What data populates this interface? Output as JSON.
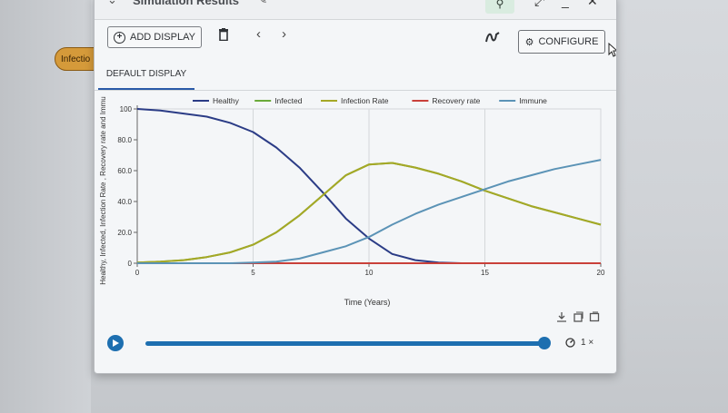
{
  "background": {
    "pill_text": "Infectio"
  },
  "window": {
    "title": "Simulation Results",
    "controls": {
      "minimize": "_",
      "maximize": "⤢",
      "close": "✕"
    }
  },
  "toolbar": {
    "add_display_label": "ADD DISPLAY",
    "configure_label": "CONFIGURE",
    "prev_label": "‹",
    "next_label": "›"
  },
  "tabs": [
    {
      "label": "DEFAULT DISPLAY",
      "active": true
    }
  ],
  "colors": {
    "healthy": "#2b3c86",
    "infected": "#6aaa3a",
    "infection_rate": "#a5a826",
    "recovery_rate": "#c9403a",
    "immune": "#5b93b6",
    "accent": "#1d6fb0"
  },
  "player": {
    "speed_label": "1 ×",
    "progress": 1.0
  },
  "chart_data": {
    "type": "line",
    "title": "",
    "xlabel": "Time (Years)",
    "ylabel": "Healthy, Infected, Infection Rate , Recovery rate and Immu",
    "xlim": [
      0,
      20
    ],
    "ylim": [
      0,
      100
    ],
    "xticks": [
      "0",
      "5",
      "10",
      "15",
      "20"
    ],
    "yticks": [
      "0",
      "20.0",
      "40.0",
      "60.0",
      "80.0",
      "100"
    ],
    "grid": "vertical",
    "legend": "top",
    "x": [
      0,
      1,
      2,
      3,
      4,
      5,
      6,
      7,
      8,
      9,
      10,
      11,
      12,
      13,
      14,
      15,
      16,
      17,
      18,
      19,
      20
    ],
    "series": [
      {
        "name": "Healthy",
        "color": "#2b3c86",
        "values": [
          100,
          99,
          97,
          95,
          91,
          85,
          75,
          62,
          46,
          29,
          16,
          6,
          2,
          0.5,
          0,
          0,
          0,
          0,
          0,
          0,
          0
        ]
      },
      {
        "name": "Infected",
        "color": "#6aaa3a",
        "values": [
          0.5,
          1,
          2,
          4,
          7,
          12,
          20,
          31,
          44,
          57,
          64,
          65,
          62,
          58,
          53,
          47,
          42,
          37,
          33,
          29,
          25
        ]
      },
      {
        "name": "Infection Rate",
        "color": "#a5a826",
        "values": [
          0.5,
          1,
          2,
          4,
          7,
          12,
          20,
          31,
          44,
          57,
          64,
          65,
          62,
          58,
          53,
          47,
          42,
          37,
          33,
          29,
          25
        ]
      },
      {
        "name": "Recovery rate",
        "color": "#c9403a",
        "values": [
          0,
          0,
          0,
          0,
          0,
          0,
          0,
          0,
          0,
          0,
          0,
          0,
          0,
          0,
          0,
          0,
          0,
          0,
          0,
          0,
          0
        ]
      },
      {
        "name": "Immune",
        "color": "#5b93b6",
        "values": [
          0,
          0,
          0,
          0,
          0,
          0.5,
          1,
          3,
          7,
          11,
          17,
          25,
          32,
          38,
          43,
          48,
          53,
          57,
          61,
          64,
          67
        ]
      }
    ]
  }
}
